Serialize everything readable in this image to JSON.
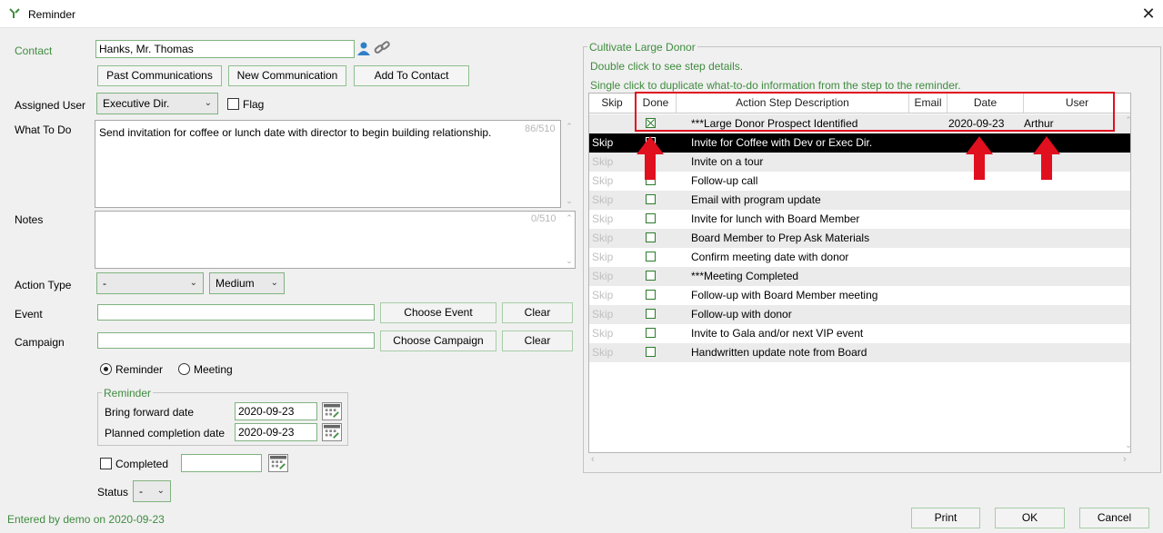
{
  "window": {
    "title": "Reminder",
    "close_icon": "close-icon"
  },
  "contact": {
    "label": "Contact",
    "value": "Hanks, Mr. Thomas",
    "buttons": {
      "past": "Past Communications",
      "new": "New Communication",
      "add": "Add To Contact"
    }
  },
  "assigned_user": {
    "label": "Assigned User",
    "value": "Executive Dir.",
    "flag_label": "Flag"
  },
  "what_to_do": {
    "label": "What To Do",
    "value": "Send invitation for coffee or lunch date with director to begin building relationship.",
    "counter": "86/510"
  },
  "notes": {
    "label": "Notes",
    "value": "",
    "counter": "0/510"
  },
  "action_type": {
    "label": "Action Type",
    "value": "-",
    "priority": "Medium"
  },
  "event": {
    "label": "Event",
    "value": "",
    "choose_label": "Choose Event",
    "clear_label": "Clear"
  },
  "campaign": {
    "label": "Campaign",
    "value": "",
    "choose_label": "Choose Campaign",
    "clear_label": "Clear"
  },
  "mode": {
    "reminder_label": "Reminder",
    "meeting_label": "Meeting",
    "selected": "Reminder"
  },
  "reminder_group": {
    "title": "Reminder",
    "bring_forward_label": "Bring forward date",
    "bring_forward_value": "2020-09-23",
    "planned_label": "Planned completion date",
    "planned_value": "2020-09-23"
  },
  "completed": {
    "label": "Completed",
    "value": ""
  },
  "status": {
    "label": "Status",
    "value": "-"
  },
  "footer": {
    "entered_by": "Entered by demo on 2020-09-23",
    "print": "Print",
    "ok": "OK",
    "cancel": "Cancel"
  },
  "steps": {
    "group_title": "Cultivate Large Donor",
    "hint1": "Double click to see step details.",
    "hint2": "Single click to duplicate what-to-do information from the step to the reminder.",
    "headers": {
      "skip": "Skip",
      "done": "Done",
      "desc": "Action Step Description",
      "email": "Email",
      "date": "Date",
      "user": "User"
    },
    "rows": [
      {
        "skip": "",
        "done": true,
        "desc": "***Large Donor Prospect Identified",
        "date": "2020-09-23",
        "user": "Arthur"
      },
      {
        "skip": "Skip",
        "done": false,
        "desc": "Invite for Coffee with Dev or Exec Dir.",
        "date": "",
        "user": ""
      },
      {
        "skip": "Skip",
        "done": false,
        "desc": "Invite on a tour",
        "date": "",
        "user": ""
      },
      {
        "skip": "Skip",
        "done": false,
        "desc": "Follow-up call",
        "date": "",
        "user": ""
      },
      {
        "skip": "Skip",
        "done": false,
        "desc": "Email with program update",
        "date": "",
        "user": ""
      },
      {
        "skip": "Skip",
        "done": false,
        "desc": "Invite for lunch with Board Member",
        "date": "",
        "user": ""
      },
      {
        "skip": "Skip",
        "done": false,
        "desc": "Board Member to Prep Ask Materials",
        "date": "",
        "user": ""
      },
      {
        "skip": "Skip",
        "done": false,
        "desc": "Confirm meeting date with donor",
        "date": "",
        "user": ""
      },
      {
        "skip": "Skip",
        "done": false,
        "desc": "***Meeting Completed",
        "date": "",
        "user": ""
      },
      {
        "skip": "Skip",
        "done": false,
        "desc": "Follow-up with Board Member meeting",
        "date": "",
        "user": ""
      },
      {
        "skip": "Skip",
        "done": false,
        "desc": "Follow-up with donor",
        "date": "",
        "user": ""
      },
      {
        "skip": "Skip",
        "done": false,
        "desc": "Invite to Gala and/or next VIP event",
        "date": "",
        "user": ""
      },
      {
        "skip": "Skip",
        "done": false,
        "desc": "Handwritten update note from Board",
        "date": "",
        "user": ""
      }
    ],
    "selected_row": 1
  },
  "colors": {
    "accent_green": "#3f8c3f",
    "annotation_red": "#e0101f",
    "selected_row": "#000000"
  }
}
